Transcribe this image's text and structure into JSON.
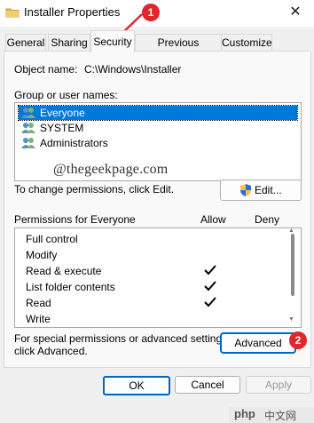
{
  "window": {
    "title": "Installer Properties",
    "close_glyph": "✕"
  },
  "tabs": [
    {
      "label": "General"
    },
    {
      "label": "Sharing"
    },
    {
      "label": "Security",
      "active": true
    },
    {
      "label": "Previous Versions"
    },
    {
      "label": "Customize"
    }
  ],
  "object": {
    "label": "Object name:",
    "value": "C:\\Windows\\Installer"
  },
  "groups": {
    "label": "Group or user names:",
    "items": [
      {
        "label": "Everyone",
        "selected": true
      },
      {
        "label": "SYSTEM",
        "selected": false
      },
      {
        "label": "Administrators",
        "selected": false
      }
    ]
  },
  "change": {
    "text": "To change permissions, click Edit.",
    "edit_label": "Edit..."
  },
  "permissions": {
    "label": "Permissions for Everyone",
    "allow_label": "Allow",
    "deny_label": "Deny",
    "items": [
      {
        "name": "Full control",
        "allow": false,
        "deny": false
      },
      {
        "name": "Modify",
        "allow": false,
        "deny": false
      },
      {
        "name": "Read & execute",
        "allow": true,
        "deny": false
      },
      {
        "name": "List folder contents",
        "allow": true,
        "deny": false
      },
      {
        "name": "Read",
        "allow": true,
        "deny": false
      },
      {
        "name": "Write",
        "allow": false,
        "deny": false
      }
    ]
  },
  "special": {
    "line1": "For special permissions or advanced settings,",
    "line2": "click Advanced.",
    "advanced_label": "Advanced"
  },
  "watermark": "@thegeekpage.com",
  "buttons": {
    "ok": "OK",
    "cancel": "Cancel",
    "apply": "Apply"
  },
  "annotations": {
    "badge1": "1",
    "badge2": "2",
    "color": "#e3262b"
  },
  "php_logo": {
    "text": "php",
    "cn": "中文网"
  }
}
